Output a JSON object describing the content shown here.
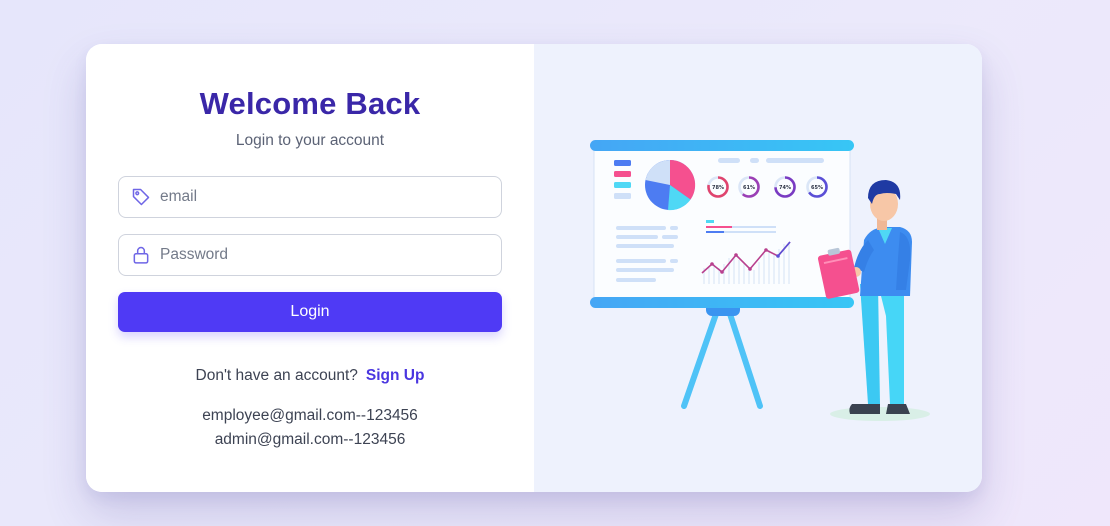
{
  "login": {
    "title": "Welcome Back",
    "subtitle": "Login to your account",
    "email_placeholder": "email",
    "password_placeholder": "Password",
    "login_label": "Login",
    "signup_prompt": "Don't have an account?",
    "signup_link": "Sign Up",
    "credentials": [
      "employee@gmail.com--123456",
      "admin@gmail.com--123456"
    ]
  },
  "illustration": {
    "gauges": [
      {
        "label": "78%",
        "value": 78,
        "color": "#e0446e"
      },
      {
        "label": "61%",
        "value": 61,
        "color": "#9b3fb5"
      },
      {
        "label": "74%",
        "value": 74,
        "color": "#7a3bc2"
      },
      {
        "label": "65%",
        "value": 65,
        "color": "#5b4fd6"
      }
    ]
  },
  "colors": {
    "accent": "#4f3af5",
    "title": "#3a27a8",
    "panel_bg": "#eef2fd"
  },
  "icons": {
    "email": "tag-icon",
    "password": "lock-icon"
  }
}
